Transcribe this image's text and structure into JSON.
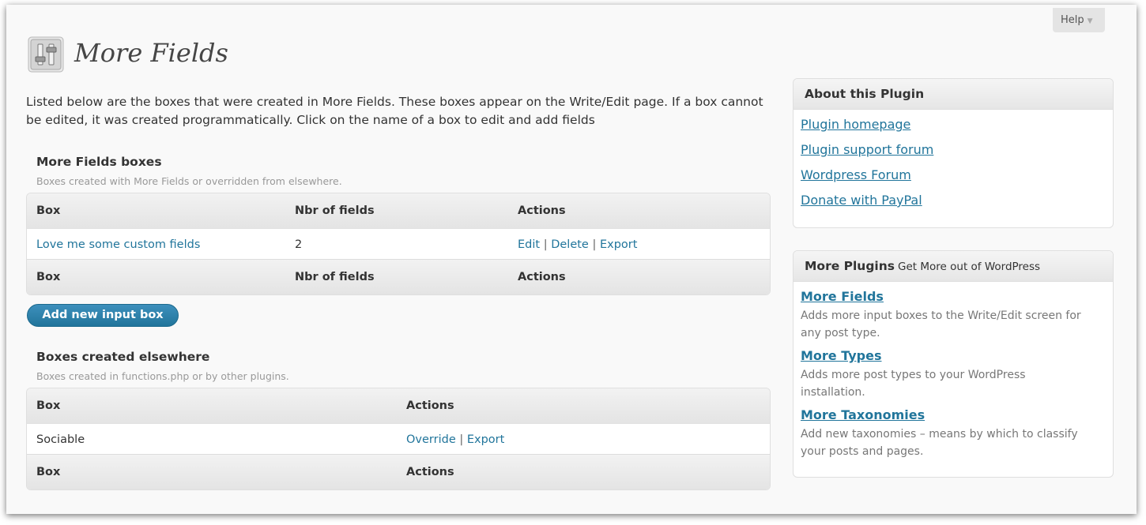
{
  "help": {
    "label": "Help",
    "arrow": "▼"
  },
  "page": {
    "title": "More Fields",
    "intro": "Listed below are the boxes that were created in More Fields. These boxes appear on the Write/Edit page. If a box cannot be edited, it was created programmatically. Click on the name of a box to edit and add fields"
  },
  "more_fields_boxes": {
    "title": "More Fields boxes",
    "description": "Boxes created with More Fields or overridden from elsewhere.",
    "columns": [
      "Box",
      "Nbr of fields",
      "Actions"
    ],
    "rows": [
      {
        "box": "Love me some custom fields",
        "count": "2",
        "actions": [
          "Edit",
          "Delete",
          "Export"
        ]
      }
    ]
  },
  "add_button": {
    "label": "Add new input box"
  },
  "elsewhere_boxes": {
    "title": "Boxes created elsewhere",
    "description": "Boxes created in functions.php or by other plugins.",
    "columns": [
      "Box",
      "Actions"
    ],
    "rows": [
      {
        "box": "Sociable",
        "actions": [
          "Override",
          "Export"
        ]
      }
    ]
  },
  "separator": "|",
  "about_plugin": {
    "title": "About this Plugin",
    "links": [
      "Plugin homepage",
      "Plugin support forum",
      "Wordpress Forum",
      "Donate with PayPal"
    ]
  },
  "more_plugins": {
    "title": "More Plugins",
    "subtitle": "Get More out of WordPress",
    "items": [
      {
        "name": "More Fields",
        "description": "Adds more input boxes to the Write/Edit screen for any post type."
      },
      {
        "name": "More Types",
        "description": "Adds more post types to your WordPress installation."
      },
      {
        "name": "More Taxonomies",
        "description": "Add new taxonomies – means by which to classify your posts and pages."
      }
    ]
  },
  "colors": {
    "link": "#21759b",
    "button": "#21759b",
    "background": "#f9f9f9"
  },
  "icons": {
    "page_icon": "settings-sliders-icon",
    "help_arrow": "triangle-down-icon"
  }
}
